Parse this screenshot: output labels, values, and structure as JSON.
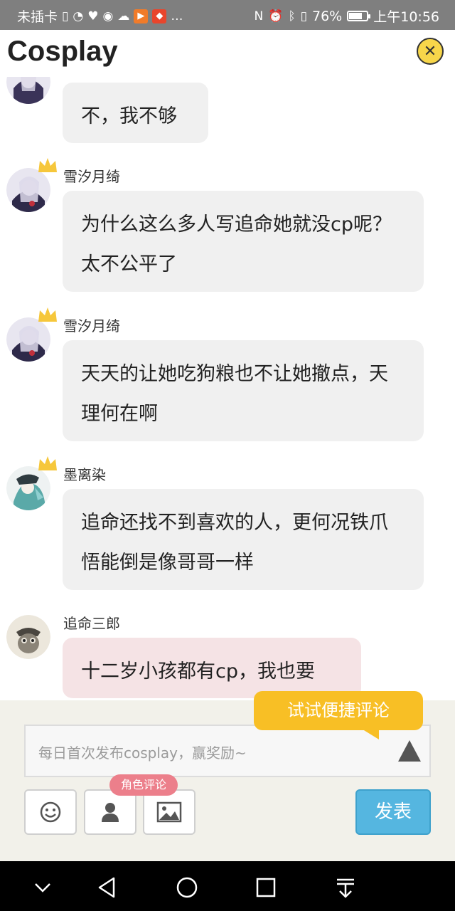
{
  "status_bar": {
    "carrier": "未插卡",
    "battery_percent": "76%",
    "battery_level": 0.76,
    "time": "上午10:56"
  },
  "header": {
    "title": "Cosplay",
    "close_icon": "close-icon"
  },
  "messages": [
    {
      "username": "",
      "text": "不，我不够",
      "style": "gray"
    },
    {
      "username": "雪汐月绮",
      "text": "为什么这么多人写追命她就没cp呢？太不公平了",
      "style": "gray",
      "crown": true
    },
    {
      "username": "雪汐月绮",
      "text": "天天的让她吃狗粮也不让她撤点，天理何在啊",
      "style": "gray",
      "crown": true
    },
    {
      "username": "墨离染",
      "text": "追命还找不到喜欢的人，更何况铁爪悟能倒是像哥哥一样",
      "style": "gray",
      "crown": true
    },
    {
      "username": "追命三郎",
      "text": "十二岁小孩都有cp，我也要",
      "style": "pink"
    }
  ],
  "composer": {
    "tip": "试试便捷评论",
    "placeholder": "每日首次发布cosplay，赢奖励~",
    "role_tag": "角色评论",
    "post_label": "发表",
    "icons": [
      "emoji-icon",
      "person-icon",
      "image-icon"
    ]
  },
  "colors": {
    "accent_blue": "#55b6e0",
    "tip_yellow": "#f8bf25",
    "tag_pink": "#ec7f8b"
  }
}
